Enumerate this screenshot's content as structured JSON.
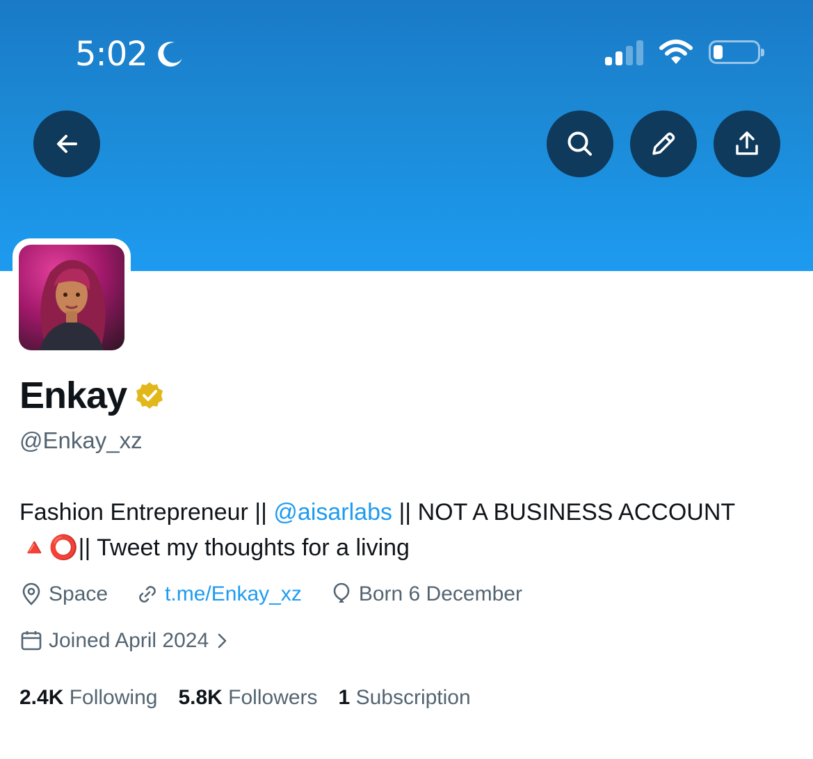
{
  "status_bar": {
    "time": "5:02",
    "icons": [
      "moon-icon",
      "signal-icon",
      "wifi-icon",
      "battery-icon"
    ],
    "battery_level": 0.2
  },
  "header": {
    "buttons": [
      "back-arrow-icon",
      "search-icon",
      "pencil-icon",
      "share-icon"
    ]
  },
  "colors": {
    "banner": "#1d9bf0",
    "button_bg": "#0f3a5c",
    "link": "#1d9bf0",
    "secondary_text": "#536471",
    "verified_badge": "#e2b719"
  },
  "profile": {
    "name": "Enkay",
    "handle": "@Enkay_xz",
    "verified_icon": "gold-verified-badge-icon",
    "bio": {
      "part1": "Fashion Entrepreneur || ",
      "mention": "@aisarlabs",
      "part2": " || NOT A BUSINESS ACCOUNT",
      "emoji": "🔺⭕",
      "part3": "|| Tweet my thoughts for a living"
    },
    "location": "Space",
    "website": "t.me/Enkay_xz",
    "birthday": "Born 6 December",
    "joined": "Joined April 2024"
  },
  "stats": {
    "following_count": "2.4K",
    "following_label": "Following",
    "followers_count": "5.8K",
    "followers_label": "Followers",
    "subscription_count": "1",
    "subscription_label": "Subscription"
  }
}
